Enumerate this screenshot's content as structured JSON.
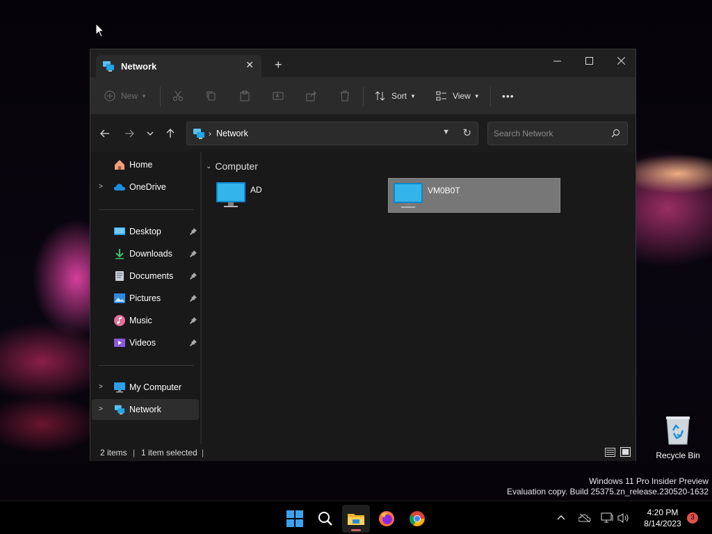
{
  "explorer": {
    "tab": {
      "title": "Network"
    },
    "toolbar": {
      "new_label": "New",
      "sort_label": "Sort",
      "view_label": "View",
      "more_label": "•••"
    },
    "address": {
      "crumbs": [
        "Network"
      ]
    },
    "search": {
      "placeholder": "Search Network"
    },
    "nav": {
      "quick": [
        {
          "label": "Home"
        },
        {
          "label": "OneDrive"
        }
      ],
      "pinned": [
        {
          "label": "Desktop"
        },
        {
          "label": "Downloads"
        },
        {
          "label": "Documents"
        },
        {
          "label": "Pictures"
        },
        {
          "label": "Music"
        },
        {
          "label": "Videos"
        }
      ],
      "locations": [
        {
          "label": "My Computer"
        },
        {
          "label": "Network"
        }
      ]
    },
    "content": {
      "group": "Computer",
      "items": [
        {
          "name": "AD",
          "selected": false
        },
        {
          "name": "VM0B0T",
          "selected": true
        }
      ]
    },
    "status": {
      "count": "2 items",
      "selection": "1 item selected"
    }
  },
  "desktop": {
    "recycle_bin_label": "Recycle Bin",
    "watermark": {
      "line1": "Windows 11 Pro Insider Preview",
      "line2": "Evaluation copy. Build 25375.zn_release.230520-1632"
    }
  },
  "taskbar": {
    "apps": [
      "start-icon",
      "search-icon",
      "file-explorer-icon",
      "firefox-icon",
      "chrome-icon"
    ],
    "clock": {
      "time": "4:20 PM",
      "date": "8/14/2023"
    },
    "notification_count": "3"
  },
  "colors": {
    "accent": "#1fa6e8",
    "selected_item": "#777777",
    "notification": "#e0504e"
  }
}
